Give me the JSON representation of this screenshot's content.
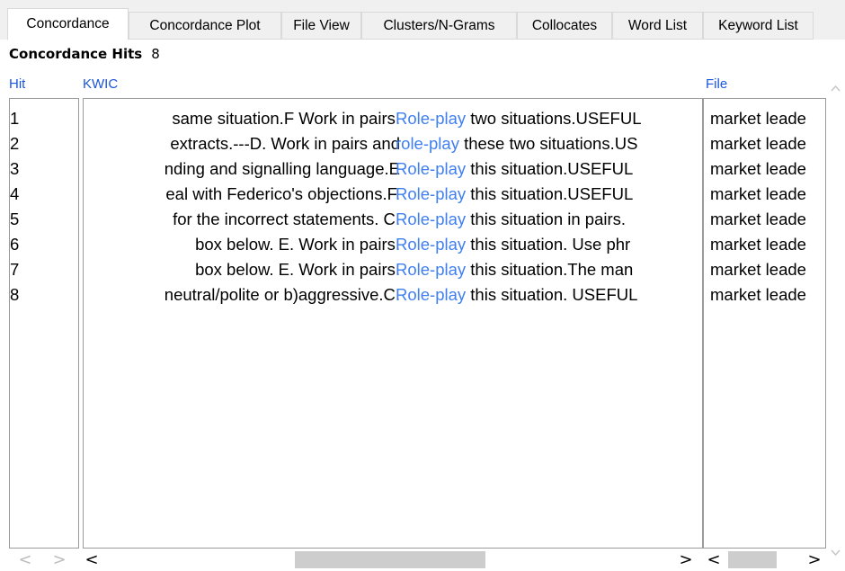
{
  "tabs": [
    {
      "label": "Concordance",
      "active": true
    },
    {
      "label": "Concordance Plot",
      "active": false
    },
    {
      "label": "File View",
      "active": false
    },
    {
      "label": "Clusters/N-Grams",
      "active": false
    },
    {
      "label": "Collocates",
      "active": false
    },
    {
      "label": "Word List",
      "active": false
    },
    {
      "label": "Keyword List",
      "active": false
    }
  ],
  "hits_label": "Concordance Hits",
  "hits_count": "8",
  "columns": {
    "hit": "Hit",
    "kwic": "KWIC",
    "file": "File"
  },
  "rows": [
    {
      "hit": "1",
      "left": "same situation.F Work in pairs.",
      "key": "Role-play",
      "right": "two situations.USEFUL",
      "file": "market leade"
    },
    {
      "hit": "2",
      "left": "extracts.---D. Work in pairs and",
      "key": "role-play",
      "right": "these two situations.US",
      "file": "market leade"
    },
    {
      "hit": "3",
      "left": "nding and signalling language.E",
      "key": "Role-play",
      "right": "this situation.USEFUL",
      "file": "market leade"
    },
    {
      "hit": "4",
      "left": "eal with Federico's objections.F.",
      "key": "Role-play",
      "right": "this situation.USEFUL",
      "file": "market leade"
    },
    {
      "hit": "5",
      "left": "for the incorrect statements. C.",
      "key": "Role-play",
      "right": "this situation in pairs.",
      "file": "market leade"
    },
    {
      "hit": "6",
      "left": "box below. E. Work in pairs.",
      "key": "Role-play",
      "right": "this situation. Use phr",
      "file": "market leade"
    },
    {
      "hit": "7",
      "left": "box below. E. Work in pairs.",
      "key": "Role-play",
      "right": "this situation.The man",
      "file": "market leade"
    },
    {
      "hit": "8",
      "left": "neutral/polite or b)aggressive.C.",
      "key": "Role-play",
      "right": "this situation. USEFUL",
      "file": "market leade"
    }
  ],
  "icons": {
    "scroll_left": "<",
    "scroll_right": ">",
    "scroll_up": "^",
    "scroll_down": "v"
  },
  "colors": {
    "keyword": "#3f7ff1",
    "column_header": "#1a55e0"
  }
}
